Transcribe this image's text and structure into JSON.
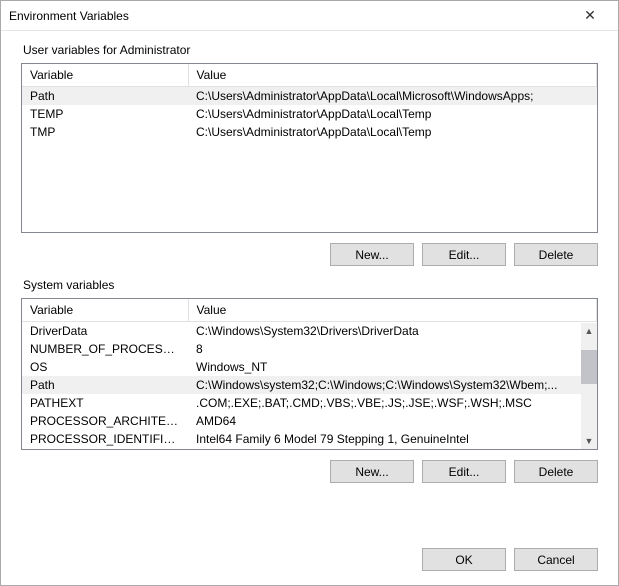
{
  "window": {
    "title": "Environment Variables"
  },
  "user_section": {
    "label": "User variables for Administrator",
    "columns": {
      "var": "Variable",
      "val": "Value"
    },
    "rows": [
      {
        "var": "Path",
        "val": "C:\\Users\\Administrator\\AppData\\Local\\Microsoft\\WindowsApps;",
        "selected": true
      },
      {
        "var": "TEMP",
        "val": "C:\\Users\\Administrator\\AppData\\Local\\Temp",
        "selected": false
      },
      {
        "var": "TMP",
        "val": "C:\\Users\\Administrator\\AppData\\Local\\Temp",
        "selected": false
      }
    ],
    "buttons": {
      "new": "New...",
      "edit": "Edit...",
      "delete": "Delete"
    }
  },
  "system_section": {
    "label": "System variables",
    "columns": {
      "var": "Variable",
      "val": "Value"
    },
    "rows": [
      {
        "var": "DriverData",
        "val": "C:\\Windows\\System32\\Drivers\\DriverData",
        "selected": false
      },
      {
        "var": "NUMBER_OF_PROCESSORS",
        "val": "8",
        "selected": false
      },
      {
        "var": "OS",
        "val": "Windows_NT",
        "selected": false
      },
      {
        "var": "Path",
        "val": "C:\\Windows\\system32;C:\\Windows;C:\\Windows\\System32\\Wbem;...",
        "selected": true
      },
      {
        "var": "PATHEXT",
        "val": ".COM;.EXE;.BAT;.CMD;.VBS;.VBE;.JS;.JSE;.WSF;.WSH;.MSC",
        "selected": false
      },
      {
        "var": "PROCESSOR_ARCHITECTURE",
        "val": "AMD64",
        "selected": false
      },
      {
        "var": "PROCESSOR_IDENTIFIER",
        "val": "Intel64 Family 6 Model 79 Stepping 1, GenuineIntel",
        "selected": false
      }
    ],
    "buttons": {
      "new": "New...",
      "edit": "Edit...",
      "delete": "Delete"
    }
  },
  "footer": {
    "ok": "OK",
    "cancel": "Cancel"
  }
}
